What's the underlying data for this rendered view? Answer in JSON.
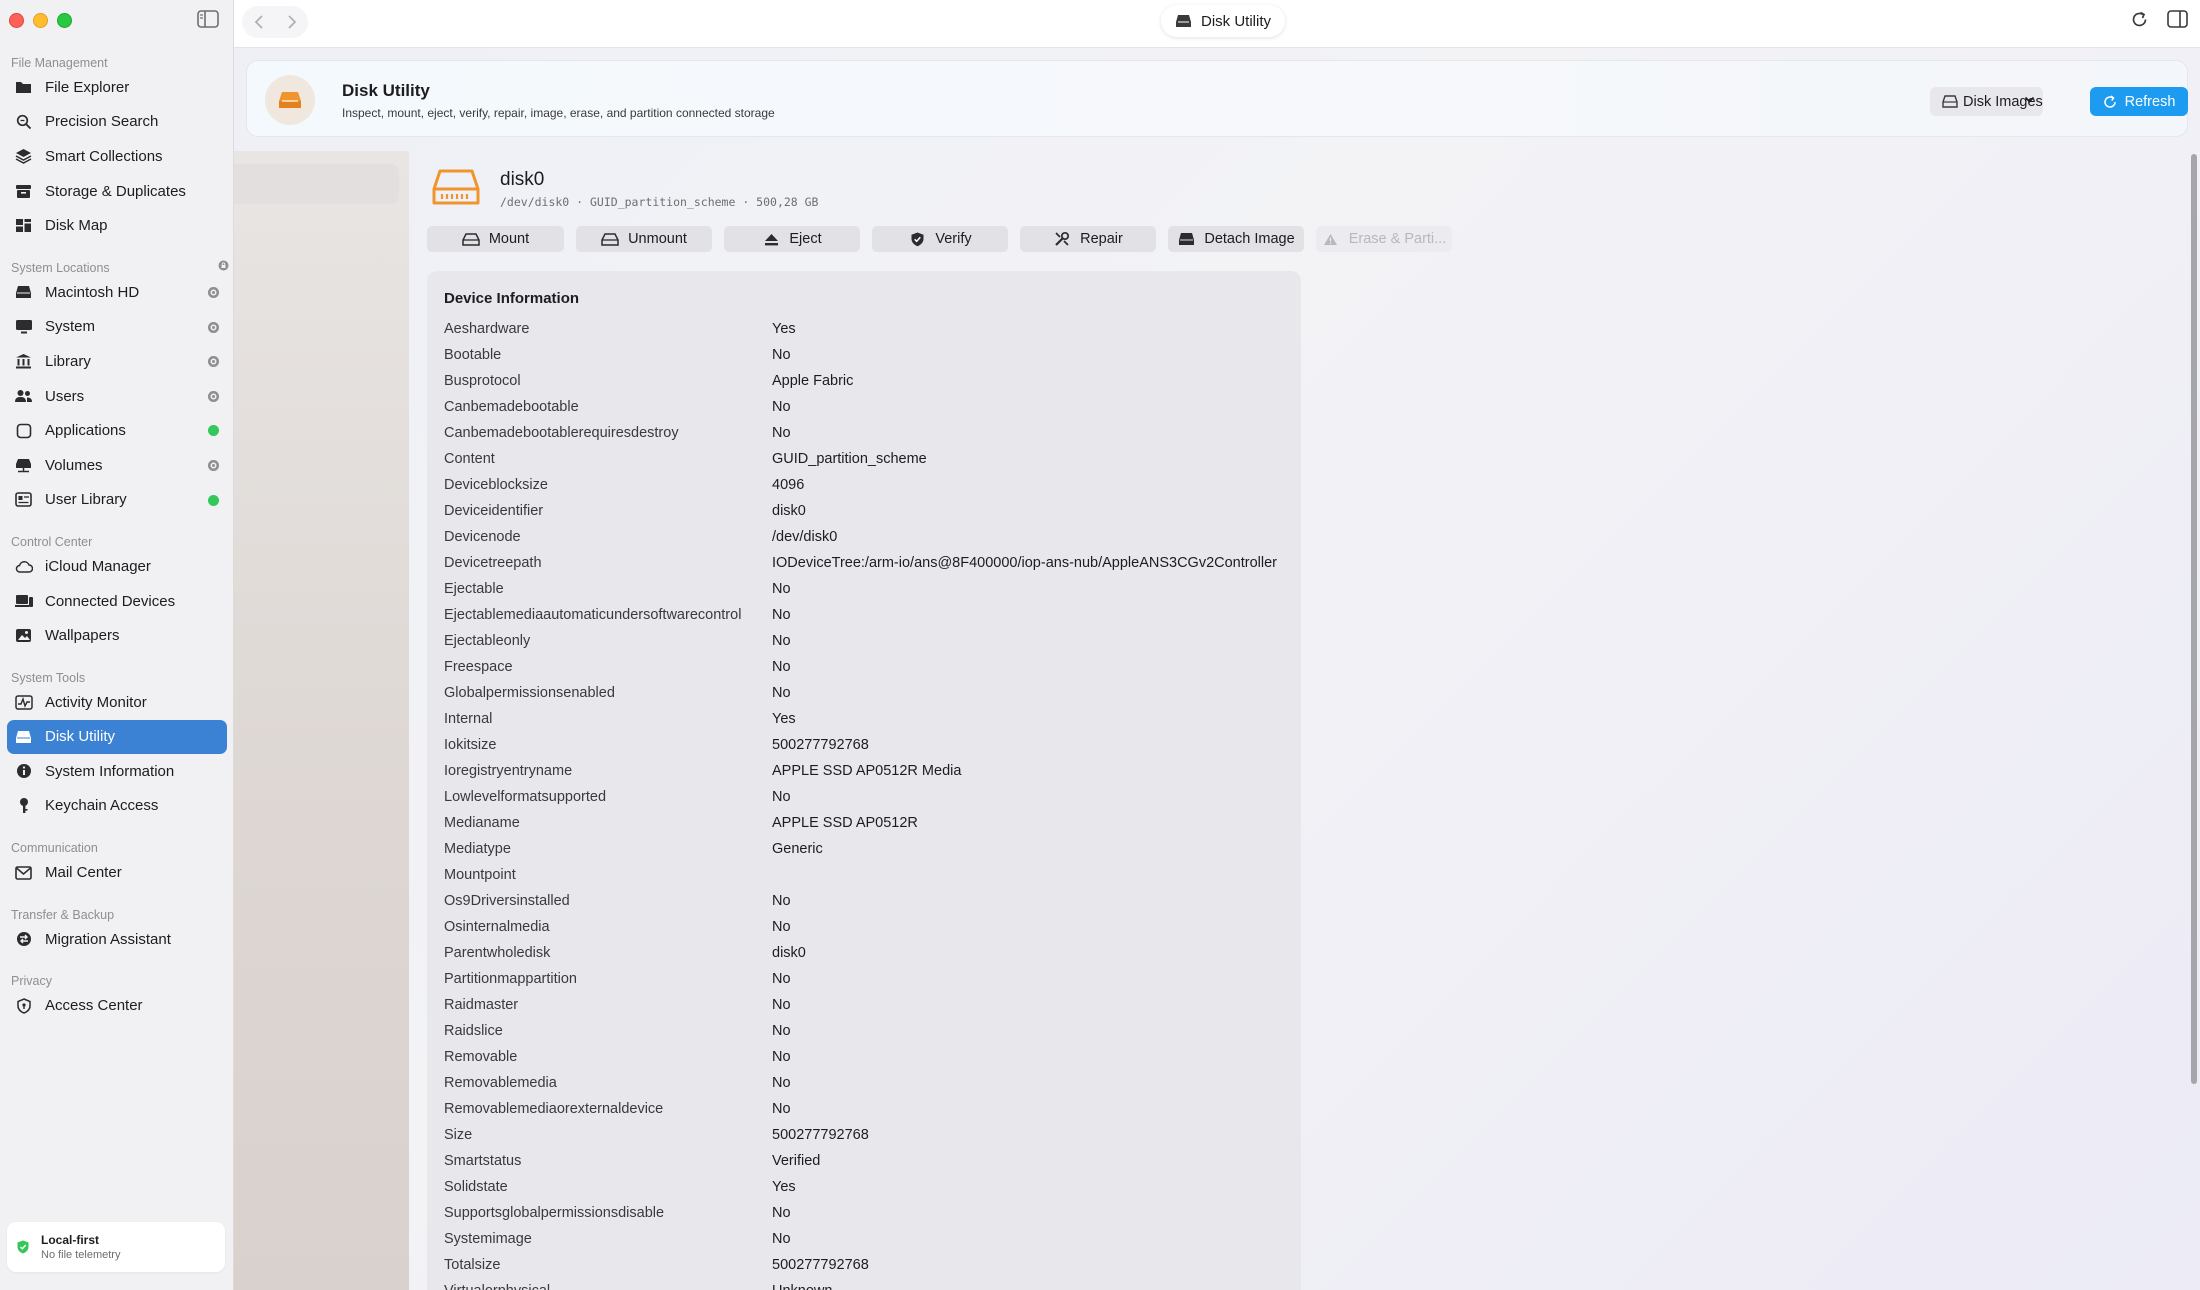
{
  "window": {
    "title": "Disk Utility"
  },
  "sidebar": {
    "sections": [
      {
        "title": "File Management",
        "items": [
          {
            "label": "File Explorer",
            "icon": "folder-icon"
          },
          {
            "label": "Precision Search",
            "icon": "search-icon"
          },
          {
            "label": "Smart Collections",
            "icon": "layers-icon"
          },
          {
            "label": "Storage & Duplicates",
            "icon": "archive-icon"
          },
          {
            "label": "Disk Map",
            "icon": "grid-icon"
          }
        ]
      },
      {
        "title": "System Locations",
        "items": [
          {
            "label": "Macintosh HD",
            "icon": "drive-icon",
            "status": "grey"
          },
          {
            "label": "System",
            "icon": "monitor-icon",
            "status": "grey"
          },
          {
            "label": "Library",
            "icon": "library-icon",
            "status": "grey"
          },
          {
            "label": "Users",
            "icon": "users-icon",
            "status": "grey"
          },
          {
            "label": "Applications",
            "icon": "app-icon",
            "status": "green"
          },
          {
            "label": "Volumes",
            "icon": "volumes-icon",
            "status": "grey"
          },
          {
            "label": "User Library",
            "icon": "user-library-icon",
            "status": "green"
          }
        ]
      },
      {
        "title": "Control Center",
        "items": [
          {
            "label": "iCloud Manager",
            "icon": "cloud-icon"
          },
          {
            "label": "Connected Devices",
            "icon": "devices-icon"
          },
          {
            "label": "Wallpapers",
            "icon": "image-icon"
          }
        ]
      },
      {
        "title": "System Tools",
        "items": [
          {
            "label": "Activity Monitor",
            "icon": "activity-icon"
          },
          {
            "label": "Disk Utility",
            "icon": "disk-icon",
            "active": true
          },
          {
            "label": "System Information",
            "icon": "info-icon"
          },
          {
            "label": "Keychain Access",
            "icon": "key-icon"
          }
        ]
      },
      {
        "title": "Communication",
        "items": [
          {
            "label": "Mail Center",
            "icon": "mail-icon"
          }
        ]
      },
      {
        "title": "Transfer & Backup",
        "items": [
          {
            "label": "Migration Assistant",
            "icon": "migration-icon"
          }
        ]
      },
      {
        "title": "Privacy",
        "items": [
          {
            "label": "Access Center",
            "icon": "shield-icon"
          }
        ]
      }
    ],
    "footer": {
      "title": "Local-first",
      "subtitle": "No file telemetry"
    }
  },
  "header": {
    "title": "Disk Utility",
    "subtitle": "Inspect, mount, eject, verify, repair, image, erase, and partition connected storage",
    "select_label": "Disk Images",
    "refresh_label": "Refresh"
  },
  "disk": {
    "name": "disk0",
    "meta": "/dev/disk0 · GUID_partition_scheme · 500,28 GB"
  },
  "actions": [
    {
      "label": "Mount",
      "icon": "mount-icon",
      "width": 137
    },
    {
      "label": "Unmount",
      "icon": "unmount-icon",
      "width": 136
    },
    {
      "label": "Eject",
      "icon": "eject-icon",
      "width": 136
    },
    {
      "label": "Verify",
      "icon": "verify-icon",
      "width": 136
    },
    {
      "label": "Repair",
      "icon": "repair-icon",
      "width": 136
    },
    {
      "label": "Detach Image",
      "icon": "detach-icon",
      "width": 136
    },
    {
      "label": "Erase & Parti...",
      "icon": "warning-icon",
      "width": 136,
      "disabled": true
    }
  ],
  "device_info": {
    "title": "Device Information",
    "rows": [
      [
        "Aeshardware",
        "Yes"
      ],
      [
        "Bootable",
        "No"
      ],
      [
        "Busprotocol",
        "Apple Fabric"
      ],
      [
        "Canbemadebootable",
        "No"
      ],
      [
        "Canbemadebootablerequiresdestroy",
        "No"
      ],
      [
        "Content",
        "GUID_partition_scheme"
      ],
      [
        "Deviceblocksize",
        "4096"
      ],
      [
        "Deviceidentifier",
        "disk0"
      ],
      [
        "Devicenode",
        "/dev/disk0"
      ],
      [
        "Devicetreepath",
        "IODeviceTree:/arm-io/ans@8F400000/iop-ans-nub/AppleANS3CGv2Controller"
      ],
      [
        "Ejectable",
        "No"
      ],
      [
        "Ejectablemediaautomaticundersoftwarecontrol",
        "No"
      ],
      [
        "Ejectableonly",
        "No"
      ],
      [
        "Freespace",
        "No"
      ],
      [
        "Globalpermissionsenabled",
        "No"
      ],
      [
        "Internal",
        "Yes"
      ],
      [
        "Iokitsize",
        "500277792768"
      ],
      [
        "Ioregistryentryname",
        "APPLE SSD AP0512R Media"
      ],
      [
        "Lowlevelformatsupported",
        "No"
      ],
      [
        "Medianame",
        "APPLE SSD AP0512R"
      ],
      [
        "Mediatype",
        "Generic"
      ],
      [
        "Mountpoint",
        ""
      ],
      [
        "Os9Driversinstalled",
        "No"
      ],
      [
        "Osinternalmedia",
        "No"
      ],
      [
        "Parentwholedisk",
        "disk0"
      ],
      [
        "Partitionmappartition",
        "No"
      ],
      [
        "Raidmaster",
        "No"
      ],
      [
        "Raidslice",
        "No"
      ],
      [
        "Removable",
        "No"
      ],
      [
        "Removablemedia",
        "No"
      ],
      [
        "Removablemediaorexternaldevice",
        "No"
      ],
      [
        "Size",
        "500277792768"
      ],
      [
        "Smartstatus",
        "Verified"
      ],
      [
        "Solidstate",
        "Yes"
      ],
      [
        "Supportsglobalpermissionsdisable",
        "No"
      ],
      [
        "Systemimage",
        "No"
      ],
      [
        "Totalsize",
        "500277792768"
      ],
      [
        "Virtualorphysical",
        "Unknown"
      ]
    ]
  },
  "colors": {
    "accent": "#1d9bf0",
    "sidebar_active": "#3b82d4",
    "disk_orange": "#f0952e",
    "status_green": "#34c759"
  }
}
